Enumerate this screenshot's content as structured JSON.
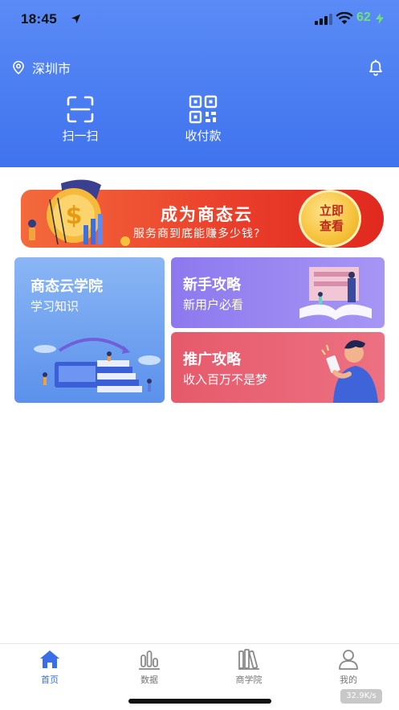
{
  "status_bar": {
    "time": "18:45",
    "battery": "62"
  },
  "header": {
    "location": "深圳市"
  },
  "quick_actions": [
    {
      "label": "扫一扫",
      "icon": "scan-icon"
    },
    {
      "label": "收付款",
      "icon": "qr-code-icon"
    }
  ],
  "banner": {
    "title": "成为商态云",
    "subtitle": "服务商到底能赚多少钱?",
    "cta_line1": "立即",
    "cta_line2": "查看"
  },
  "cards": {
    "academy": {
      "title": "商态云学院",
      "subtitle": "学习知识"
    },
    "newbie": {
      "title": "新手攻略",
      "subtitle": "新用户必看"
    },
    "promo": {
      "title": "推广攻略",
      "subtitle": "收入百万不是梦"
    }
  },
  "tabbar": {
    "items": [
      {
        "label": "首页",
        "icon": "home-icon",
        "active": true
      },
      {
        "label": "数据",
        "icon": "bar-chart-icon",
        "active": false
      },
      {
        "label": "商学院",
        "icon": "books-icon",
        "active": false
      },
      {
        "label": "我的",
        "icon": "user-icon",
        "active": false
      }
    ]
  },
  "network_speed": "32.9K/s",
  "colors": {
    "header_blue": "#4a7cf1",
    "active_tab": "#3a6ee8",
    "battery_green": "#6fe07c"
  }
}
